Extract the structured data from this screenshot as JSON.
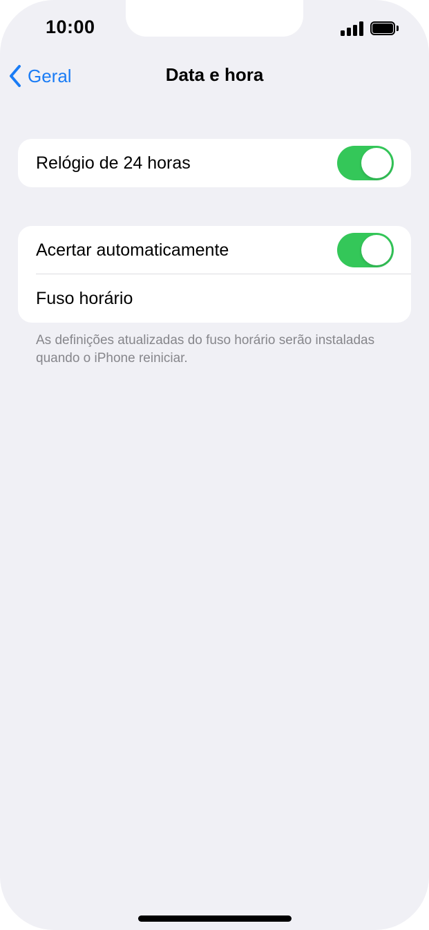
{
  "status_bar": {
    "time": "10:00",
    "signal_icon": "cellular-signal-icon",
    "battery_icon": "battery-icon"
  },
  "nav": {
    "back_label": "Geral",
    "back_icon": "chevron-left-icon",
    "title": "Data e hora"
  },
  "groups": [
    {
      "rows": [
        {
          "label": "Relógio de 24 horas",
          "toggle_on": true
        }
      ]
    },
    {
      "rows": [
        {
          "label": "Acertar automaticamente",
          "toggle_on": true
        },
        {
          "label": "Fuso horário"
        }
      ],
      "footer": "As definições atualizadas do fuso horário serão instaladas quando o iPhone reiniciar."
    }
  ],
  "colors": {
    "accent": "#1a7cf5",
    "toggle_on": "#34c759",
    "background": "#f0f0f5",
    "footer_text": "#86868b"
  }
}
